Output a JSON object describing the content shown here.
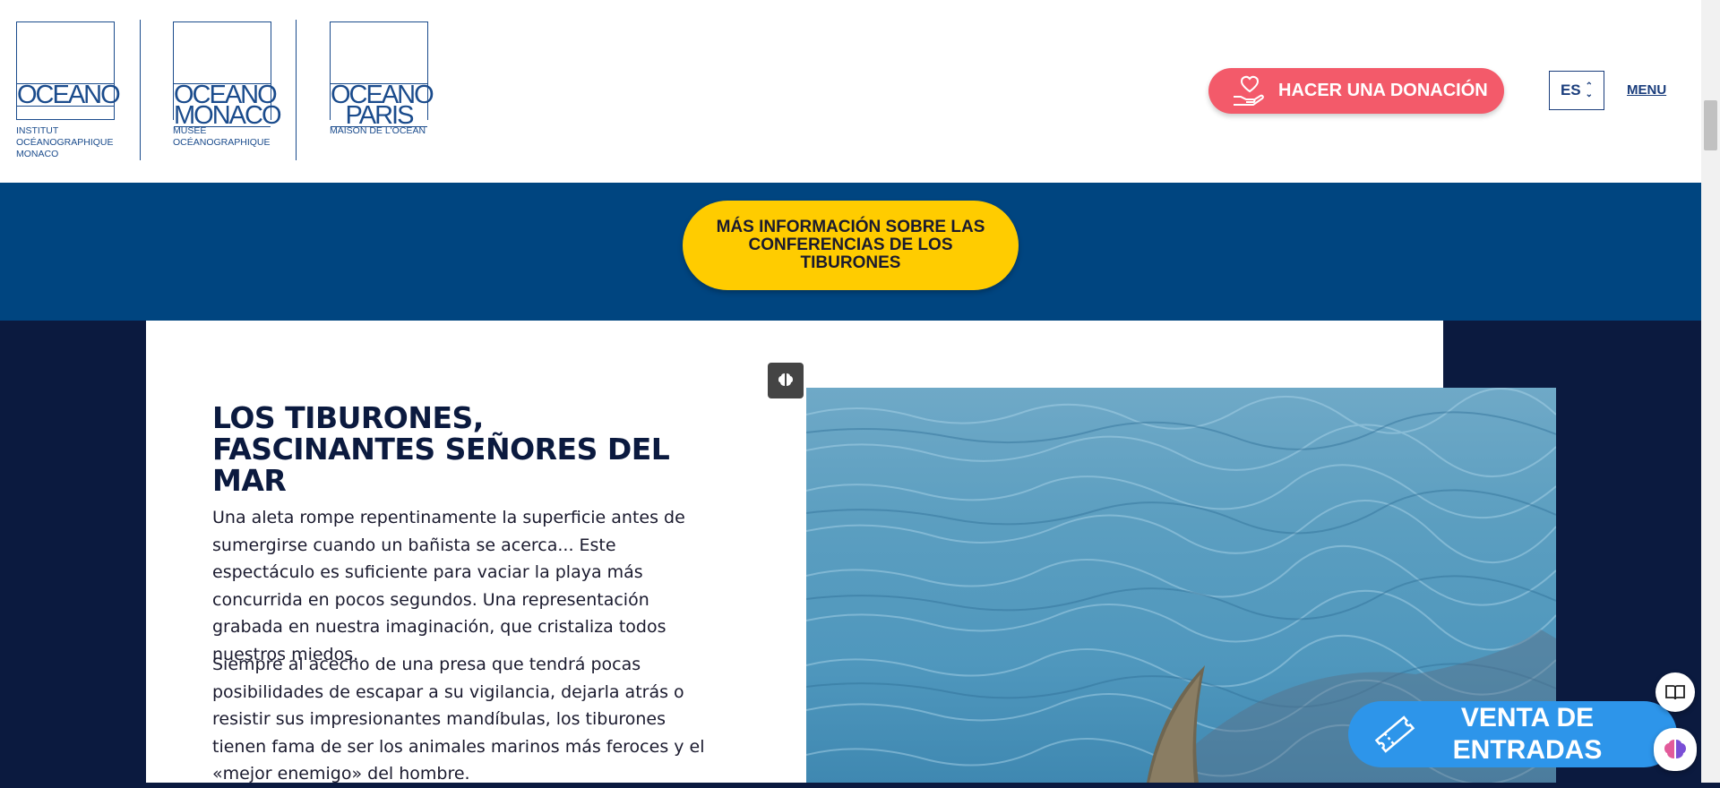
{
  "header": {
    "logos": [
      {
        "line1": "OCEANO",
        "line2": "",
        "subtitle": [
          "INSTITUT",
          "OCÉANOGRAPHIQUE",
          "MONACO"
        ]
      },
      {
        "line1": "OCEANO",
        "line2": "MONACO",
        "subtitle": [
          "MUSÉE",
          "OCÉANOGRAPHIQUE"
        ]
      },
      {
        "line1": "OCEANO",
        "line2": "PARIS",
        "subtitle": [
          "MAISON DE L'OCÉAN"
        ]
      }
    ],
    "donate_label": "HACER UNA DONACIÓN",
    "language": "ES",
    "menu_label": "MENU"
  },
  "banner": {
    "more_info_label": "MÁS INFORMACIÓN SOBRE LAS CONFERENCIAS DE LOS TIBURONES"
  },
  "article": {
    "heading": "LOS TIBURONES, FASCINANTES SEÑORES DEL MAR",
    "paragraphs": [
      "Una aleta rompe repentinamente la superficie antes de sumergirse cuando un bañista se acerca... Este espectáculo es suficiente para vaciar la playa más concurrida en pocos segundos. Una representación grabada en nuestra imaginación, que cristaliza todos nuestros miedos.",
      "Siempre al acecho de una presa que tendrá pocas posibilidades de escapar a su vigilancia, dejarla atrás o resistir sus impresionantes mandíbulas, los tiburones tienen fama de ser los animales marinos más feroces y el «mejor enemigo» del hombre."
    ]
  },
  "tickets": {
    "label": "VENTA DE ENTRADAS"
  },
  "colors": {
    "navy": "#0b1a3f",
    "brand_blue": "#004580",
    "donate_red": "#f35a6a",
    "cta_yellow": "#ffcc00",
    "tickets_blue": "#2d95ea"
  },
  "icons": {
    "donate": "heart-hand-icon",
    "ai_badge": "brain-icon",
    "tickets": "ticket-icon",
    "reader": "book-icon",
    "assistant": "brain-icon"
  }
}
